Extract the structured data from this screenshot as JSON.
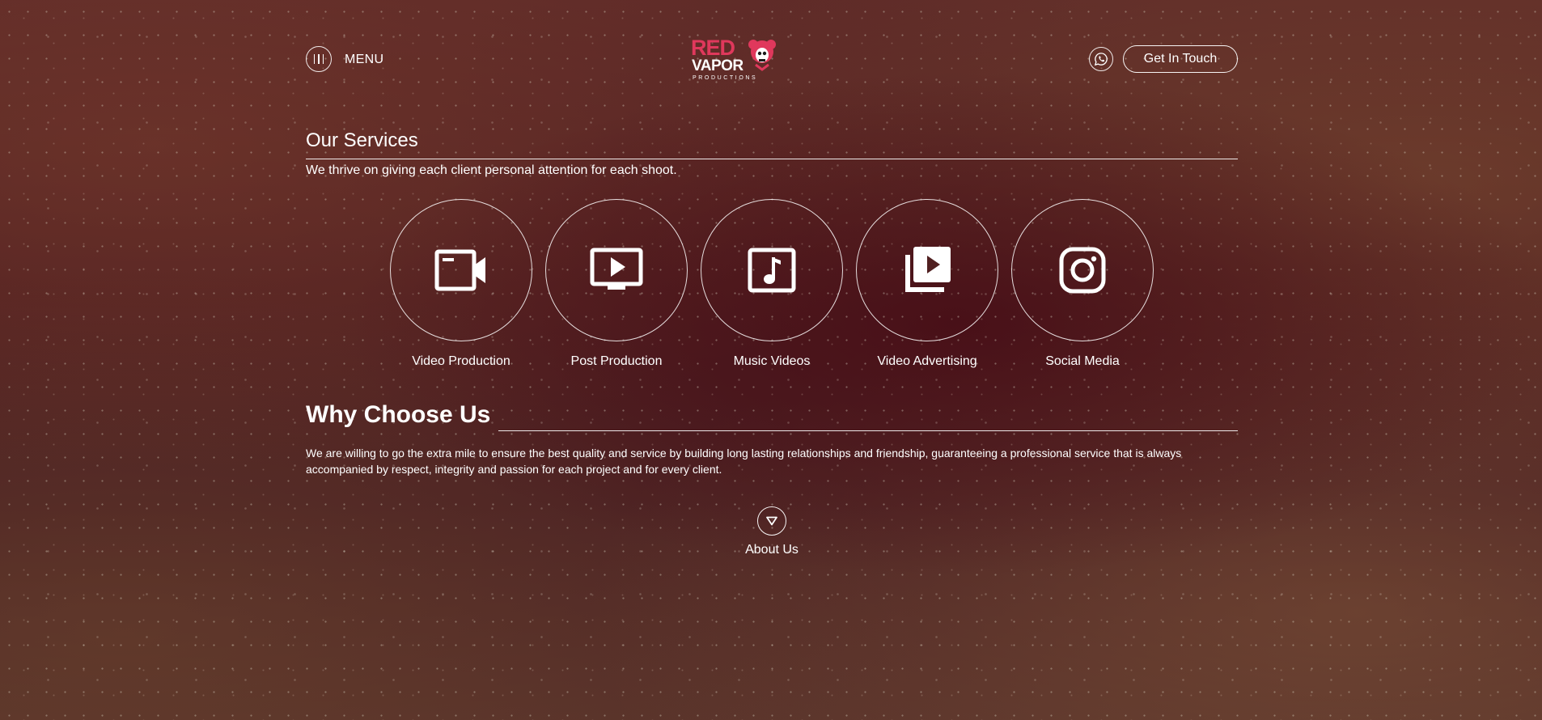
{
  "header": {
    "menu_label": "MENU",
    "logo": {
      "line1": "RED",
      "line2": "VAPOR",
      "line3": "PRODUCTIONS",
      "brand_color": "#e0385c"
    },
    "whatsapp_icon": "whatsapp-icon",
    "cta_label": "Get In Touch"
  },
  "services": {
    "title": "Our Services",
    "subtitle": "We thrive on giving each client personal attention for each shoot.",
    "items": [
      {
        "label": "Video Production",
        "icon": "video-camera-icon"
      },
      {
        "label": "Post Production",
        "icon": "play-monitor-icon"
      },
      {
        "label": "Music Videos",
        "icon": "music-note-icon"
      },
      {
        "label": "Video Advertising",
        "icon": "video-library-icon"
      },
      {
        "label": "Social Media",
        "icon": "instagram-icon"
      }
    ]
  },
  "why": {
    "title": "Why Choose Us",
    "text": "We are willing to go the extra mile to ensure the best quality and service by building long lasting relationships and friendship, guaranteeing a professional service that is always accompanied by respect, integrity and passion for each project and for every client."
  },
  "about": {
    "label": "About Us",
    "icon": "chevron-down-icon"
  }
}
